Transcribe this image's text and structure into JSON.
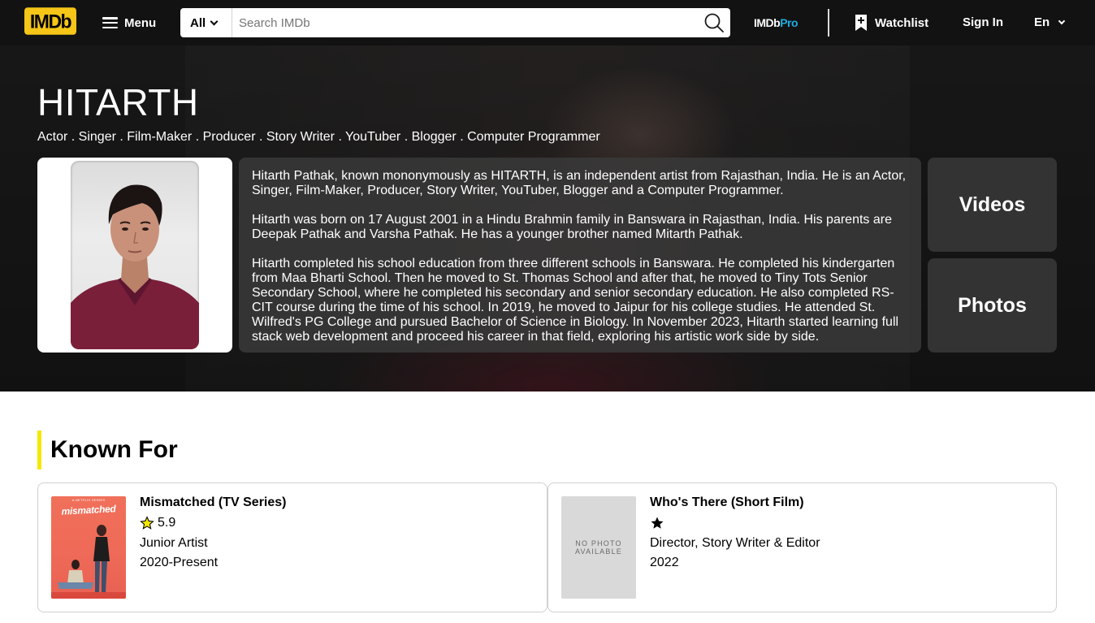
{
  "header": {
    "logo_text": "IMDb",
    "menu_label": "Menu",
    "search": {
      "category": "All",
      "placeholder": "Search IMDb"
    },
    "pro_label_a": "IMDb",
    "pro_label_b": "Pro",
    "watchlist_label": "Watchlist",
    "signin_label": "Sign In",
    "language_label": "En"
  },
  "profile": {
    "name": "HITARTH",
    "professions": "Actor . Singer . Film-Maker . Producer . Story Writer . YouTuber . Blogger . Computer Programmer",
    "bio": [
      "Hitarth Pathak, known mononymously as HITARTH, is an independent artist from Rajasthan, India. He is an Actor, Singer, Film-Maker, Producer, Story Writer, YouTuber, Blogger and a Computer Programmer.",
      "Hitarth was born on 17 August 2001 in a Hindu Brahmin family in Banswara in Rajasthan, India. His parents are Deepak Pathak and Varsha Pathak. He has a younger brother named Mitarth Pathak.",
      "Hitarth completed his school education from three different schools in Banswara. He completed his kindergarten from Maa Bharti School. Then he moved to St. Thomas School and after that, he moved to Tiny Tots Senior Secondary School, where he completed his secondary and senior secondary education. He also completed RS-CIT course during the time of his school. In 2019, he moved to Jaipur for his college studies. He attended St. Wilfred's PG College and pursued Bachelor of Science in Biology. In November 2023, Hitarth started learning full stack web development and proceed his career in that field, exploring his artistic work side by side."
    ],
    "videos_label": "Videos",
    "photos_label": "Photos"
  },
  "known_for": {
    "heading": "Known For",
    "accent_color": "#f5e800",
    "items": [
      {
        "title": "Mismatched (TV Series)",
        "rating": "5.9",
        "role": "Junior Artist",
        "years": "2020-Present",
        "poster_text": "mismatched",
        "poster_tagline": "A NETFLIX SERIES"
      },
      {
        "title": "Who's There (Short Film)",
        "rating": "",
        "role": "Director, Story Writer & Editor",
        "years": "2022",
        "poster_text": "NO PHOTO AVAILABLE"
      }
    ]
  },
  "colors": {
    "brand_yellow": "#f5c518",
    "topbar": "#121212",
    "pro_blue": "#1eabe1"
  }
}
